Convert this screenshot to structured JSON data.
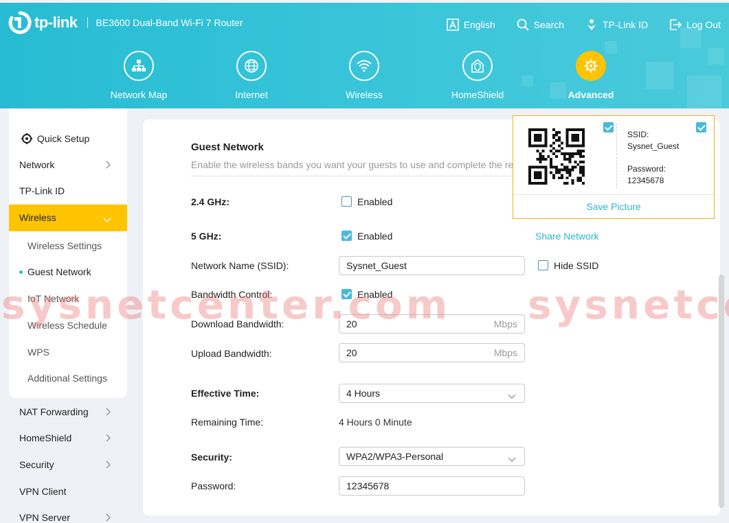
{
  "header": {
    "brand": "tp-link",
    "model": "BE3600 Dual-Band Wi-Fi 7 Router",
    "actions": [
      {
        "label": "English",
        "icon": "language-icon"
      },
      {
        "label": "Search",
        "icon": "search-icon"
      },
      {
        "label": "TP-Link ID",
        "icon": "tplink-id-icon"
      },
      {
        "label": "Log Out",
        "icon": "logout-icon"
      }
    ],
    "nav": [
      {
        "label": "Network Map",
        "icon": "network-map-icon",
        "active": false
      },
      {
        "label": "Internet",
        "icon": "globe-icon",
        "active": false
      },
      {
        "label": "Wireless",
        "icon": "wifi-icon",
        "active": false
      },
      {
        "label": "HomeShield",
        "icon": "homeshield-icon",
        "active": false
      },
      {
        "label": "Advanced",
        "icon": "gear-icon",
        "active": true
      }
    ]
  },
  "sidebar": {
    "items": [
      {
        "label": "Quick Setup",
        "icon": "quick-setup-icon"
      },
      {
        "label": "Network"
      },
      {
        "label": "TP-Link ID"
      },
      {
        "label": "Wireless",
        "selected": true
      },
      {
        "label": "NAT Forwarding"
      },
      {
        "label": "HomeShield"
      },
      {
        "label": "Security"
      },
      {
        "label": "VPN Client"
      },
      {
        "label": "VPN Server"
      }
    ],
    "subitems": [
      {
        "label": "Wireless Settings"
      },
      {
        "label": "Guest Network",
        "active": true
      },
      {
        "label": "IoT Network"
      },
      {
        "label": "Wireless Schedule"
      },
      {
        "label": "WPS"
      },
      {
        "label": "Additional Settings"
      }
    ]
  },
  "main": {
    "title": "Guest Network",
    "description": "Enable the wireless bands you want your guests to use and complete the related settings.",
    "band24": {
      "label": "2.4 GHz:",
      "checkbox_label": "Enabled",
      "checked": false
    },
    "band5": {
      "label": "5 GHz:",
      "checkbox_label": "Enabled",
      "checked": true,
      "share_label": "Share Network"
    },
    "ssid": {
      "label": "Network Name (SSID):",
      "value": "Sysnet_Guest",
      "hide_label": "Hide SSID",
      "hide_checked": false
    },
    "bandwidth_control": {
      "label": "Bandwidth Control:",
      "checkbox_label": "Enabled",
      "checked": true
    },
    "download": {
      "label": "Download Bandwidth:",
      "value": "20",
      "unit": "Mbps"
    },
    "upload": {
      "label": "Upload Bandwidth:",
      "value": "20",
      "unit": "Mbps"
    },
    "effective_time": {
      "label": "Effective Time:",
      "value": "4 Hours"
    },
    "remaining_time": {
      "label": "Remaining Time:",
      "value": "4 Hours 0 Minute"
    },
    "security": {
      "label": "Security:",
      "value": "WPA2/WPA3-Personal"
    },
    "password": {
      "label": "Password:",
      "value": "12345678"
    }
  },
  "share_popup": {
    "ssid_label": "SSID:",
    "ssid_value": "Sysnet_Guest",
    "password_label": "Password:",
    "password_value": "12345678",
    "save_label": "Save Picture",
    "qr_checked": true,
    "info_checked": true
  },
  "watermark": "sysnetcenter.com",
  "colors": {
    "accent": "#2fb4cc",
    "header": "#33c2d8",
    "selected": "#ffc400"
  }
}
